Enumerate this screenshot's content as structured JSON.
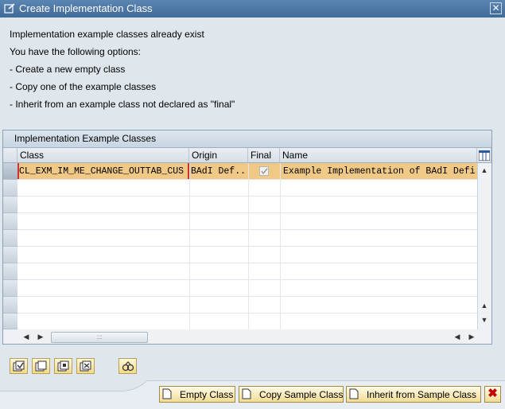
{
  "window": {
    "title": "Create Implementation Class",
    "close_glyph": "✕"
  },
  "messages": [
    "Implementation example classes already exist",
    "You have the following options:",
    "- Create a new empty class",
    "- Copy one of the example classes",
    "- Inherit from an example class not declared as \"final\""
  ],
  "panel": {
    "title": "Implementation Example Classes",
    "columns": [
      "Class",
      "Origin",
      "Final",
      "Name"
    ],
    "rows": [
      {
        "class": "CL_EXM_IM_ME_CHANGE_OUTTAB_CUS",
        "origin": "BAdI Def...",
        "final": true,
        "name": "Example Implementation of BAdI Defi"
      }
    ],
    "empty_rows": 9
  },
  "toolbar_icons": [
    "select-all-icon",
    "deselect-all-icon",
    "select-block-icon",
    "deselect-block-icon",
    "details-icon"
  ],
  "buttons": {
    "empty_class": "Empty Class",
    "copy_sample": "Copy Sample Class",
    "inherit_sample": "Inherit from Sample Class"
  },
  "colors": {
    "selected_row": "#f0c987",
    "titlebar": "#4a76a5",
    "cancel": "#c00000"
  }
}
